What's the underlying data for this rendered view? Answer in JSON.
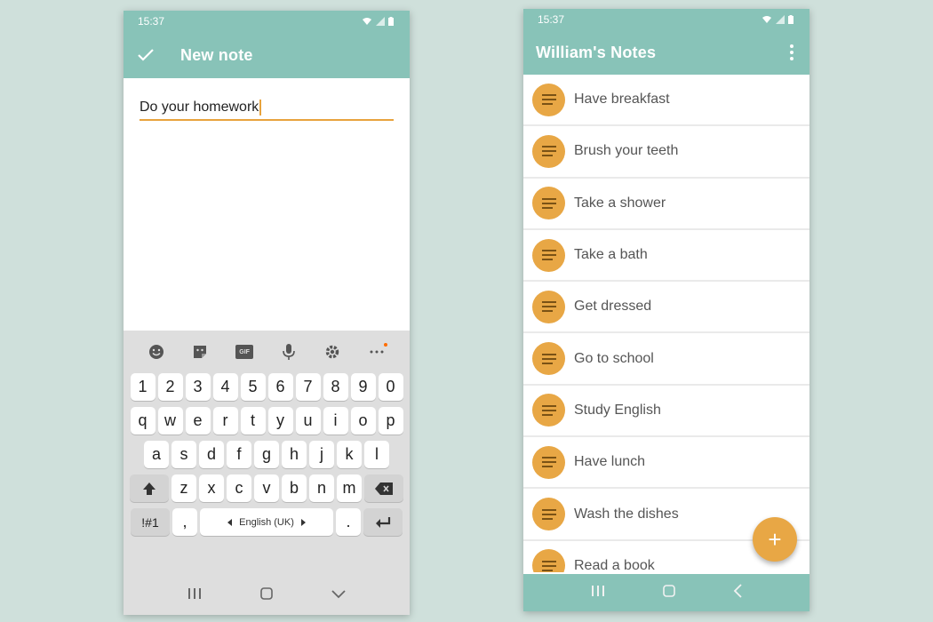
{
  "left_phone": {
    "status_time": "15:37",
    "appbar": {
      "title": "New note",
      "confirm_icon": "check-icon"
    },
    "note_text": "Do your homework",
    "keyboard": {
      "toolbar_icons": [
        "emoji-icon",
        "sticker-icon",
        "gif-icon",
        "microphone-icon",
        "gear-icon",
        "more-icon"
      ],
      "gif_label": "GIF",
      "number_row": [
        "1",
        "2",
        "3",
        "4",
        "5",
        "6",
        "7",
        "8",
        "9",
        "0"
      ],
      "row1": [
        "q",
        "w",
        "e",
        "r",
        "t",
        "y",
        "u",
        "i",
        "o",
        "p"
      ],
      "row2": [
        "a",
        "s",
        "d",
        "f",
        "g",
        "h",
        "j",
        "k",
        "l"
      ],
      "row3": [
        "z",
        "x",
        "c",
        "v",
        "b",
        "n",
        "m"
      ],
      "symbols_key": "!#1",
      "comma_key": ",",
      "space_label": "English (UK)",
      "period_key": "."
    }
  },
  "right_phone": {
    "status_time": "15:37",
    "appbar": {
      "title": "William's Notes"
    },
    "notes": [
      "Have breakfast",
      "Brush your teeth",
      "Take a shower",
      "Take a bath",
      "Get dressed",
      "Go to school",
      "Study English",
      "Have lunch",
      "Wash the dishes",
      "Read a book"
    ],
    "fab_label": "+"
  },
  "colors": {
    "teal": "#88c3b8",
    "accent": "#e8a745",
    "background": "#cfe0db"
  }
}
